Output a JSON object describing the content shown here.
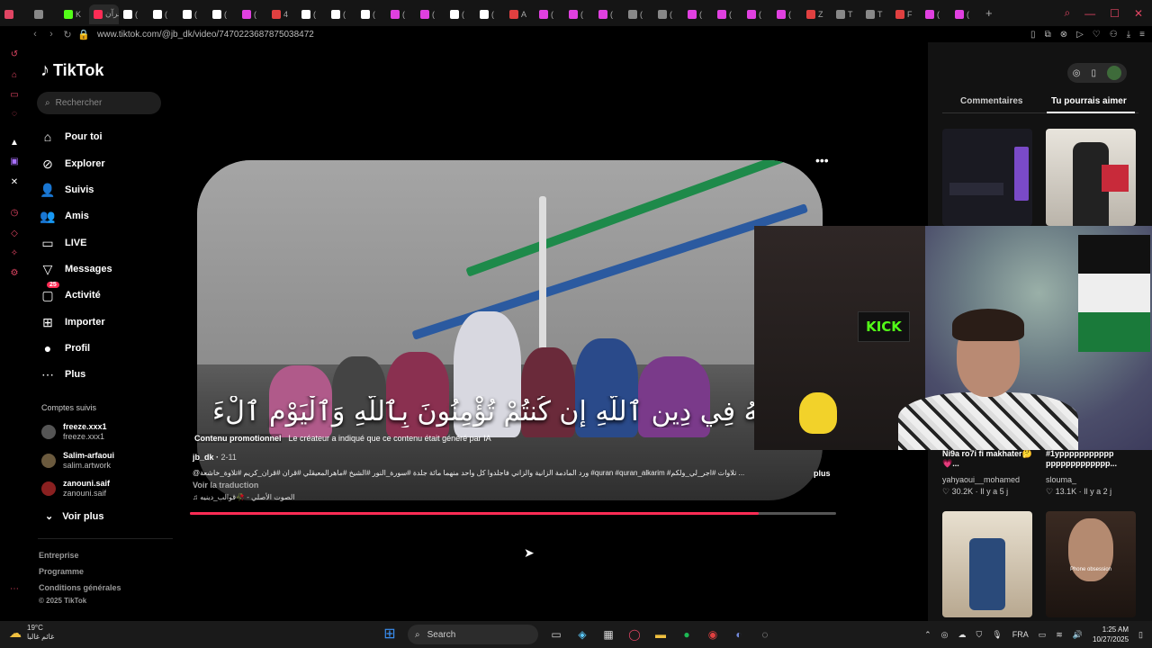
{
  "browser": {
    "tabs": [
      {
        "title": "",
        "color": "#e04563"
      },
      {
        "title": "",
        "color": "#888"
      },
      {
        "title": "K",
        "color": "#53fc18"
      },
      {
        "title": "قرآن",
        "color": "#fe2c55",
        "active": true
      },
      {
        "title": "(",
        "color": "#fff"
      },
      {
        "title": "(",
        "color": "#fff"
      },
      {
        "title": "(",
        "color": "#fff"
      },
      {
        "title": "(",
        "color": "#fff"
      },
      {
        "title": "(",
        "color": "#e040e0"
      },
      {
        "title": "4",
        "color": "#e04040"
      },
      {
        "title": "(",
        "color": "#fff"
      },
      {
        "title": "(",
        "color": "#fff"
      },
      {
        "title": "(",
        "color": "#fff"
      },
      {
        "title": "(",
        "color": "#e040e0"
      },
      {
        "title": "(",
        "color": "#e040e0"
      },
      {
        "title": "(",
        "color": "#fff"
      },
      {
        "title": "(",
        "color": "#fff"
      },
      {
        "title": "A",
        "color": "#e04040"
      },
      {
        "title": "(",
        "color": "#e040e0"
      },
      {
        "title": "(",
        "color": "#e040e0"
      },
      {
        "title": "(",
        "color": "#e040e0"
      },
      {
        "title": "(",
        "color": "#888"
      },
      {
        "title": "(",
        "color": "#888"
      },
      {
        "title": "(",
        "color": "#e040e0"
      },
      {
        "title": "(",
        "color": "#e040e0"
      },
      {
        "title": "(",
        "color": "#e040e0"
      },
      {
        "title": "(",
        "color": "#e040e0"
      },
      {
        "title": "Z",
        "color": "#e04040"
      },
      {
        "title": "T",
        "color": "#888"
      },
      {
        "title": "T",
        "color": "#888"
      },
      {
        "title": "F",
        "color": "#e04040"
      },
      {
        "title": "(",
        "color": "#e040e0"
      },
      {
        "title": "(",
        "color": "#e040e0"
      }
    ],
    "new_tab": "+",
    "url": "www.tiktok.com/@jb_dk/video/7470223687875038472"
  },
  "sidebar": {
    "logo": "TikTok",
    "search_placeholder": "Rechercher",
    "nav": [
      {
        "label": "Pour toi",
        "icon": "home-icon",
        "glyph": "⌂"
      },
      {
        "label": "Explorer",
        "icon": "compass-icon",
        "glyph": "⊘"
      },
      {
        "label": "Suivis",
        "icon": "following-icon",
        "glyph": "👤"
      },
      {
        "label": "Amis",
        "icon": "friends-icon",
        "glyph": "👥"
      },
      {
        "label": "LIVE",
        "icon": "live-icon",
        "glyph": "▭"
      },
      {
        "label": "Messages",
        "icon": "messages-icon",
        "glyph": "▽"
      },
      {
        "label": "Activité",
        "icon": "activity-icon",
        "glyph": "▢",
        "badge": "25"
      },
      {
        "label": "Importer",
        "icon": "upload-icon",
        "glyph": "⊞"
      },
      {
        "label": "Profil",
        "icon": "profile-icon",
        "glyph": "●"
      },
      {
        "label": "Plus",
        "icon": "more-icon",
        "glyph": "⋯"
      }
    ],
    "following_title": "Comptes suivis",
    "following": [
      {
        "name": "freeze.xxx1",
        "user": "freeze.xxx1",
        "color": "#555"
      },
      {
        "name": "Salim-arfaoui",
        "user": "salim.artwork",
        "color": "#6b5a3e"
      },
      {
        "name": "zanouni.saif",
        "user": "zanouni.saif",
        "color": "#8a2020"
      }
    ],
    "see_more": "Voir plus",
    "footer": [
      "Entreprise",
      "Programme",
      "Conditions générales",
      "© 2025 TikTok"
    ]
  },
  "video": {
    "caption_arabic": "فَهُ فِي دِينِ ٱللَّهِ إِن كُنتُمْ تُؤْمِنُونَ بِٱللَّهِ وَٱلْيَوْمِ ٱلْءَاخِرِ وَلْيَشْهَدْ",
    "promo_label": "Contenu promotionnel",
    "ai_notice": "Le créateur a indiqué que ce contenu était généré par IA",
    "author": "jb_dk",
    "date": "2-11",
    "description": "@ورد المادمة  الزانية والزاني فاجلدوا كل واحد منهما مائة جلدة #سورة_النور #الشيخ #ماهرالمعيقلي #قران #قران_كريم #تلاوة_خاشعة #quran #quran_alkarim #تلاوات #اجر_لي_ولكم ...",
    "more": "plus",
    "translate": "Voir la traduction",
    "music": "♫ الصوت الأصلي - 🥀قوالب_دينيه",
    "progress": 0.88
  },
  "right_panel": {
    "tabs": [
      "Commentaires",
      "Tu pourrais aimer"
    ],
    "active_tab": 1,
    "cards": [
      {
        "caption": "Ni9a ro7i fi makhater🤔💗...",
        "user": "yahyaoui__mohamed",
        "likes": "30.2K",
        "age": "Il y a 5 j"
      },
      {
        "caption": "#1yppppppppppp ppppppppppppp...",
        "user": "slouma_",
        "likes": "13.1K",
        "age": "Il y a 2 j"
      }
    ],
    "overlay_text": "Phone obsession"
  },
  "webcam": {
    "sign": "KICK"
  },
  "taskbar": {
    "temp": "19°C",
    "weather_desc": "غائم غالبا",
    "search": "Search",
    "lang": "FRA",
    "time": "1:25 AM",
    "date": "10/27/2025"
  }
}
